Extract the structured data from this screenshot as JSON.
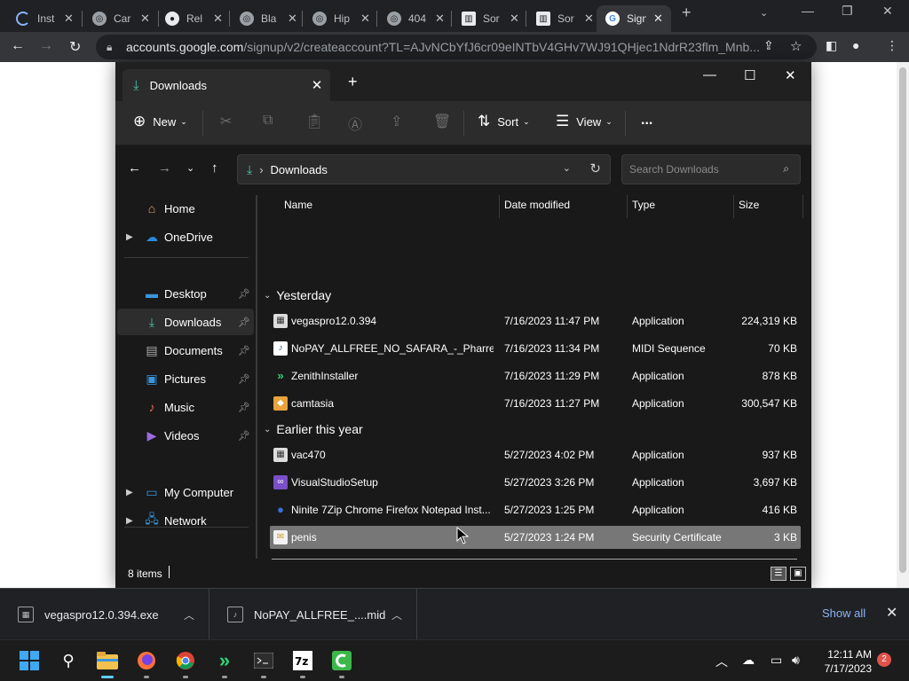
{
  "browser": {
    "tabs": [
      {
        "title": "Inst",
        "icon": "loading-spinner-icon"
      },
      {
        "title": "Car",
        "icon": "globe-icon"
      },
      {
        "title": "Rel",
        "icon": "github-icon"
      },
      {
        "title": "Bla",
        "icon": "globe-icon"
      },
      {
        "title": "Hip",
        "icon": "globe-icon"
      },
      {
        "title": "404",
        "icon": "globe-icon"
      },
      {
        "title": "Sor",
        "icon": "bank-icon"
      },
      {
        "title": "Sor",
        "icon": "bank-icon"
      },
      {
        "title": "Sign",
        "icon": "google-icon",
        "active": true
      }
    ],
    "url_host": "accounts.google.com",
    "url_path": "/signup/v2/createaccount?TL=AJvNCbYfJ6cr09eINTbV4GHv7WJ91QHjec1NdrR23flm_Mnb..."
  },
  "explorer": {
    "tab_title": "Downloads",
    "commands": {
      "new": "New",
      "sort": "Sort",
      "view": "View",
      "more": "..."
    },
    "address": "Downloads",
    "search_placeholder": "Search Downloads",
    "nav": {
      "home": "Home",
      "onedrive": "OneDrive",
      "desktop": "Desktop",
      "downloads": "Downloads",
      "documents": "Documents",
      "pictures": "Pictures",
      "music": "Music",
      "videos": "Videos",
      "my_computer": "My Computer",
      "network": "Network"
    },
    "columns": {
      "name": "Name",
      "date": "Date modified",
      "type": "Type",
      "size": "Size"
    },
    "groups": [
      {
        "label": "Yesterday",
        "files": [
          {
            "name": "vegaspro12.0.394",
            "date": "7/16/2023 11:47 PM",
            "type": "Application",
            "size": "224,319 KB",
            "icon": "installer-icon"
          },
          {
            "name": "NoPAY_ALLFREE_NO_SAFARA_-_Pharrel_...",
            "date": "7/16/2023 11:34 PM",
            "type": "MIDI Sequence",
            "size": "70 KB",
            "icon": "midi-file-icon"
          },
          {
            "name": "ZenithInstaller",
            "date": "7/16/2023 11:29 PM",
            "type": "Application",
            "size": "878 KB",
            "icon": "zenith-icon"
          },
          {
            "name": "camtasia",
            "date": "7/16/2023 11:27 PM",
            "type": "Application",
            "size": "300,547 KB",
            "icon": "camtasia-icon"
          }
        ]
      },
      {
        "label": "Earlier this year",
        "files": [
          {
            "name": "vac470",
            "date": "5/27/2023 4:02 PM",
            "type": "Application",
            "size": "937 KB",
            "icon": "installer-icon"
          },
          {
            "name": "VisualStudioSetup",
            "date": "5/27/2023 3:26 PM",
            "type": "Application",
            "size": "3,697 KB",
            "icon": "visual-studio-icon"
          },
          {
            "name": "Ninite 7Zip Chrome Firefox Notepad Inst...",
            "date": "5/27/2023 1:25 PM",
            "type": "Application",
            "size": "416 KB",
            "icon": "ninite-icon"
          },
          {
            "name": "penis",
            "date": "5/27/2023 1:24 PM",
            "type": "Security Certificate",
            "size": "3 KB",
            "icon": "certificate-icon",
            "selected": true
          }
        ]
      }
    ],
    "status": "8 items"
  },
  "downloads_bar": {
    "items": [
      {
        "name": "vegaspro12.0.394.exe"
      },
      {
        "name": "NoPAY_ALLFREE_....mid"
      }
    ],
    "show_all": "Show all"
  },
  "taskbar": {
    "time": "12:11 AM",
    "date": "7/17/2023",
    "notifications": "2"
  }
}
